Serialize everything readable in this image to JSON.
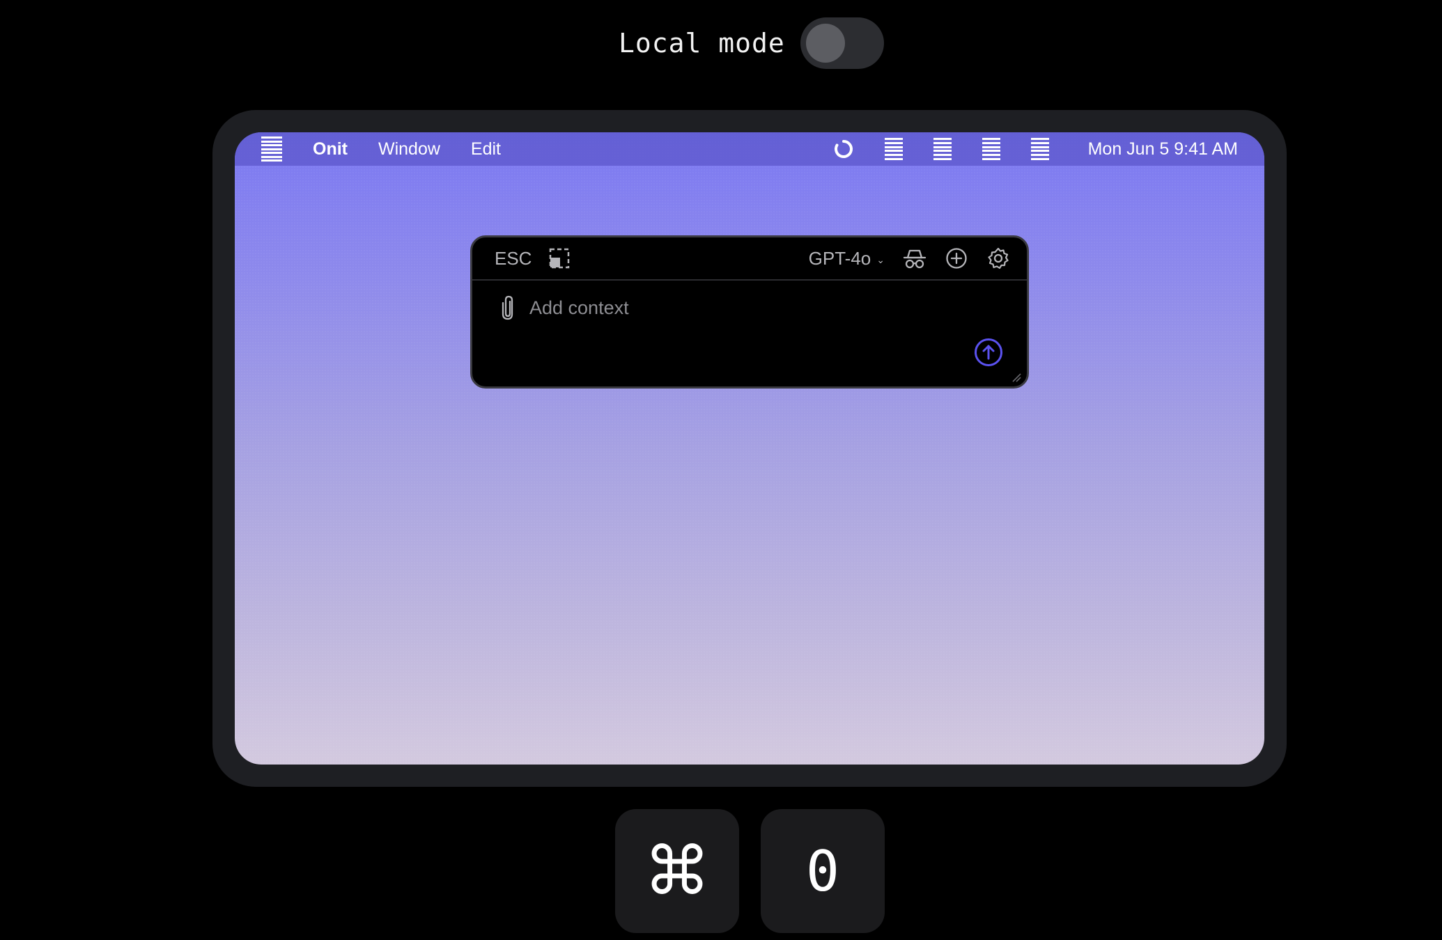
{
  "local_mode": {
    "label": "Local mode",
    "enabled": false
  },
  "menubar": {
    "app_name": "Onit",
    "items": [
      "Window",
      "Edit"
    ],
    "clock": "Mon Jun 5  9:41 AM",
    "status_icons": [
      "loading-icon",
      "menu-extra-icon",
      "menu-extra-icon",
      "menu-extra-icon",
      "menu-extra-icon"
    ]
  },
  "panel": {
    "esc_label": "ESC",
    "model_label": "GPT-4o",
    "context_placeholder": "Add context",
    "icons": [
      "selection-icon",
      "incognito-icon",
      "new-chat-icon",
      "settings-icon",
      "paperclip-icon",
      "send-icon"
    ]
  },
  "keys": {
    "modifier": "⌘",
    "key": "0"
  },
  "colors": {
    "accent": "#5b52f0",
    "wallpaper_top": "#7b78f2",
    "wallpaper_bottom": "#d3c9df",
    "frame": "#1e1f23"
  }
}
